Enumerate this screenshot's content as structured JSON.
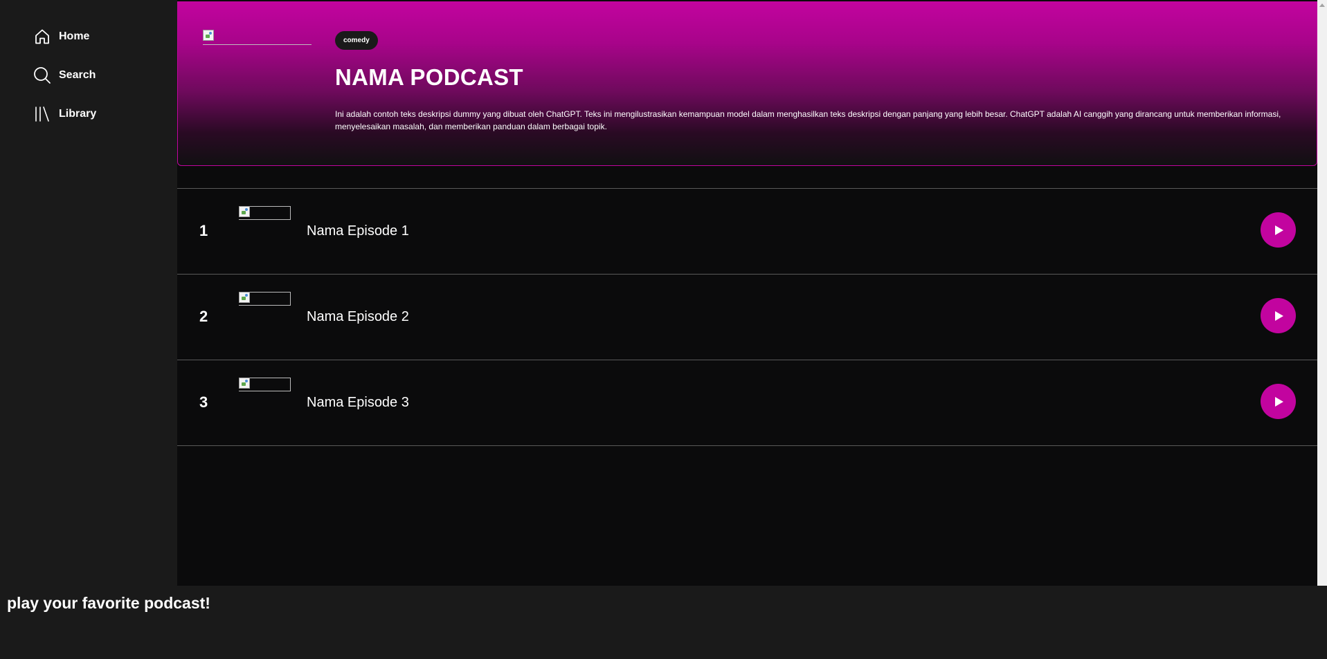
{
  "sidebar": {
    "items": [
      {
        "label": "Home",
        "icon": "home-icon"
      },
      {
        "label": "Search",
        "icon": "search-icon"
      },
      {
        "label": "Library",
        "icon": "library-icon"
      }
    ]
  },
  "podcast": {
    "category": "comedy",
    "title": "NAMA PODCAST",
    "description": "Ini adalah contoh teks deskripsi dummy yang dibuat oleh ChatGPT. Teks ini mengilustrasikan kemampuan model dalam menghasilkan teks deskripsi dengan panjang yang lebih besar. ChatGPT adalah AI canggih yang dirancang untuk memberikan informasi, menyelesaikan masalah, dan memberikan panduan dalam berbagai topik."
  },
  "episodes": [
    {
      "number": "1",
      "title": "Nama Episode 1"
    },
    {
      "number": "2",
      "title": "Nama Episode 2"
    },
    {
      "number": "3",
      "title": "Nama Episode 3"
    }
  ],
  "footer": {
    "text": "play your favorite podcast!"
  },
  "colors": {
    "accent": "#c2049f",
    "sidebar_bg": "#1a1a1a",
    "main_bg": "#0b0b0c"
  }
}
